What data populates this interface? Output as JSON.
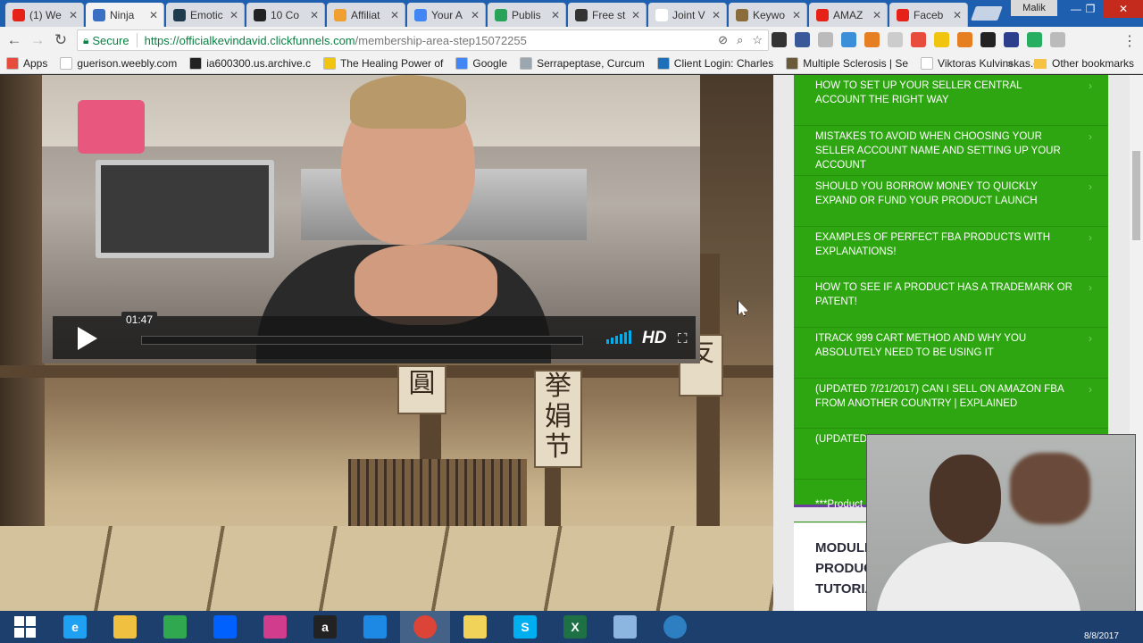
{
  "browser": {
    "tabs": [
      {
        "label": "(1) We",
        "favicon_color": "#e62117",
        "icon": "youtube-icon"
      },
      {
        "label": "Ninja",
        "favicon_color": "#3a6fc4",
        "icon": "ninja-icon",
        "active": true
      },
      {
        "label": "Emotic",
        "favicon_color": "#1d3b4d",
        "icon": "emotiv-icon"
      },
      {
        "label": "10 Co",
        "favicon_color": "#222222",
        "icon": "e-icon"
      },
      {
        "label": "Affiliat",
        "favicon_color": "#f0a030",
        "icon": "affiliate-icon"
      },
      {
        "label": "Your A",
        "favicon_color": "#4285f4",
        "icon": "loading-icon"
      },
      {
        "label": "Publis",
        "favicon_color": "#29a35a",
        "icon": "publish-icon"
      },
      {
        "label": "Free st",
        "favicon_color": "#333333",
        "icon": "camera-icon"
      },
      {
        "label": "Joint V",
        "favicon_color": "#ffffff",
        "icon": "document-icon"
      },
      {
        "label": "Keywo",
        "favicon_color": "#8a6d3b",
        "icon": "keyword-icon"
      },
      {
        "label": "AMAZ",
        "favicon_color": "#e62117",
        "icon": "youtube-icon"
      },
      {
        "label": "Faceb",
        "favicon_color": "#e62117",
        "icon": "youtube-icon"
      }
    ],
    "profile_name": "Malik",
    "window_buttons": {
      "minimize": "—",
      "restore": "❐",
      "close": "✕"
    }
  },
  "address_bar": {
    "secure_label": "Secure",
    "url_host": "https://officialkevindavid.clickfunnels.com",
    "url_path": "/membership-area-step15072255"
  },
  "bookmarks": {
    "items": [
      {
        "label": "Apps",
        "color": "#e74c3c"
      },
      {
        "label": "guerison.weebly.com",
        "color": "#ffffff"
      },
      {
        "label": "ia600300.us.archive.c",
        "color": "#222222"
      },
      {
        "label": "The Healing Power of",
        "color": "#f1c40f"
      },
      {
        "label": "Google",
        "color": "#4285f4"
      },
      {
        "label": "Serrapeptase, Curcum",
        "color": "#9aa7b0"
      },
      {
        "label": "Client Login: Charles",
        "color": "#1c6fb8"
      },
      {
        "label": "Multiple Sclerosis | Se",
        "color": "#6a5a3a"
      },
      {
        "label": "Viktoras Kulvinskas.c",
        "color": "#ffffff"
      }
    ],
    "more": "»",
    "other": "Other bookmarks"
  },
  "video": {
    "timestamp": "01:47",
    "hd_label": "HD"
  },
  "lessons": [
    "HOW TO SET UP YOUR SELLER CENTRAL ACCOUNT THE RIGHT WAY",
    "MISTAKES TO AVOID WHEN CHOOSING YOUR SELLER ACCOUNT NAME AND SETTING UP YOUR ACCOUNT",
    "SHOULD YOU BORROW MONEY TO QUICKLY EXPAND OR FUND YOUR PRODUCT LAUNCH",
    "EXAMPLES OF PERFECT FBA PRODUCTS WITH EXPLANATIONS!",
    "HOW TO SEE IF A PRODUCT HAS A TRADEMARK OR PATENT!",
    "ITRACK 999 CART METHOD AND WHY YOU ABSOLUTELY NEED TO BE USING IT",
    "(UPDATED 7/21/2017) CAN I SELL ON AMAZON FBA FROM ANOTHER COUNTRY | EXPLAINED",
    "(UPDATED 7... 'YOUR LIST...",
    "***Product R..."
  ],
  "module_card": {
    "title": "MODULE\nPRODUC\nTUTORIA"
  },
  "scene_signs": [
    "圓",
    "挙\n娟\n节",
    "友"
  ],
  "taskbar": {
    "apps": [
      {
        "name": "windows-start",
        "label": ""
      },
      {
        "name": "internet-explorer",
        "label": "e",
        "color": "#1ea1f2"
      },
      {
        "name": "file-explorer",
        "label": "",
        "color": "#f0c040"
      },
      {
        "name": "store",
        "label": "",
        "color": "#2fa84f"
      },
      {
        "name": "dropbox",
        "label": "",
        "color": "#0061fe"
      },
      {
        "name": "photos",
        "label": "",
        "color": "#d23c8c"
      },
      {
        "name": "amazon",
        "label": "a",
        "color": "#222222"
      },
      {
        "name": "onedrive",
        "label": "",
        "color": "#1e88e5"
      },
      {
        "name": "chrome",
        "label": "",
        "color": "#db4437",
        "active": true
      },
      {
        "name": "sticky-notes",
        "label": "",
        "color": "#f2d35a"
      },
      {
        "name": "skype",
        "label": "S",
        "color": "#00aff0"
      },
      {
        "name": "excel",
        "label": "X",
        "color": "#1e7145"
      },
      {
        "name": "paint",
        "label": "",
        "color": "#8cb6e0"
      },
      {
        "name": "recorder",
        "label": "",
        "color": "#2d7fc1"
      }
    ],
    "clock": "8/8/2017"
  }
}
